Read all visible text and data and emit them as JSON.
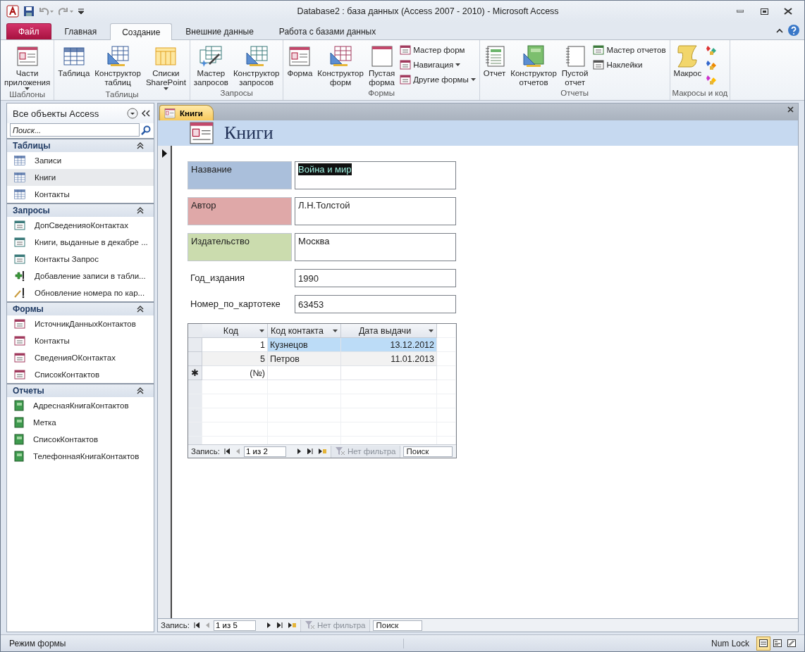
{
  "window": {
    "title": "Database2 : база данных (Access 2007 - 2010)  -  Microsoft Access"
  },
  "ribbon_tabs": [
    {
      "label": "Файл",
      "kind": "file",
      "selected": false
    },
    {
      "label": "Главная",
      "kind": "tab",
      "selected": false
    },
    {
      "label": "Создание",
      "kind": "tab",
      "selected": true
    },
    {
      "label": "Внешние данные",
      "kind": "tab",
      "selected": false
    },
    {
      "label": "Работа с базами данных",
      "kind": "tab",
      "selected": false
    }
  ],
  "ribbon_groups": [
    {
      "label": "Шаблоны",
      "items": [
        {
          "kind": "large",
          "lines": [
            "Части",
            "приложения"
          ],
          "dropdown": true
        }
      ]
    },
    {
      "label": "Таблицы",
      "items": [
        {
          "kind": "large",
          "lines": [
            "Таблица"
          ],
          "dropdown": false
        },
        {
          "kind": "large",
          "lines": [
            "Конструктор",
            "таблиц"
          ],
          "dropdown": false
        },
        {
          "kind": "large",
          "lines": [
            "Списки",
            "SharePoint"
          ],
          "dropdown": true
        }
      ]
    },
    {
      "label": "Запросы",
      "items": [
        {
          "kind": "large",
          "lines": [
            "Мастер",
            "запросов"
          ],
          "dropdown": false
        },
        {
          "kind": "large",
          "lines": [
            "Конструктор",
            "запросов"
          ],
          "dropdown": false
        }
      ]
    },
    {
      "label": "Формы",
      "items": [
        {
          "kind": "large",
          "lines": [
            "Форма"
          ],
          "dropdown": false
        },
        {
          "kind": "large",
          "lines": [
            "Конструктор",
            "форм"
          ],
          "dropdown": false
        },
        {
          "kind": "large",
          "lines": [
            "Пустая",
            "форма"
          ],
          "dropdown": false
        },
        {
          "kind": "small",
          "lines": [
            "Мастер форм"
          ],
          "dropdown": false
        },
        {
          "kind": "small",
          "lines": [
            "Навигация"
          ],
          "dropdown": true
        },
        {
          "kind": "small",
          "lines": [
            "Другие формы"
          ],
          "dropdown": true
        }
      ]
    },
    {
      "label": "Отчеты",
      "items": [
        {
          "kind": "large",
          "lines": [
            "Отчет"
          ],
          "dropdown": false
        },
        {
          "kind": "large",
          "lines": [
            "Конструктор",
            "отчетов"
          ],
          "dropdown": false
        },
        {
          "kind": "large",
          "lines": [
            "Пустой",
            "отчет"
          ],
          "dropdown": false
        },
        {
          "kind": "small",
          "lines": [
            "Мастер отчетов"
          ],
          "dropdown": false
        },
        {
          "kind": "small",
          "lines": [
            "Наклейки"
          ],
          "dropdown": false
        }
      ]
    },
    {
      "label": "Макросы и код",
      "items": [
        {
          "kind": "large",
          "lines": [
            "Макрос"
          ],
          "dropdown": false
        },
        {
          "kind": "icon"
        },
        {
          "kind": "icon"
        },
        {
          "kind": "icon"
        }
      ]
    }
  ],
  "nav_pane": {
    "title": "Все объекты Access",
    "search": {
      "placeholder": "Поиск..."
    },
    "groups": [
      {
        "title": "Таблицы",
        "expanded": true,
        "items": [
          {
            "label": "Записи",
            "kind": "table",
            "selected": false
          },
          {
            "label": "Книги",
            "kind": "table",
            "selected": true
          },
          {
            "label": "Контакты",
            "kind": "table",
            "selected": false
          }
        ]
      },
      {
        "title": "Запросы",
        "expanded": true,
        "items": [
          {
            "label": "ДопСведенияоКонтактах",
            "kind": "query",
            "selected": false
          },
          {
            "label": "Книги, выданные в декабре ...",
            "kind": "query",
            "selected": false
          },
          {
            "label": "Контакты Запрос",
            "kind": "query",
            "selected": false
          },
          {
            "label": "Добавление записи в табли...",
            "kind": "append",
            "selected": false
          },
          {
            "label": "Обновление номера по кар...",
            "kind": "update",
            "selected": false
          }
        ]
      },
      {
        "title": "Формы",
        "expanded": true,
        "items": [
          {
            "label": "ИсточникДанныхКонтактов",
            "kind": "form",
            "selected": false
          },
          {
            "label": "Контакты",
            "kind": "form",
            "selected": false
          },
          {
            "label": "СведенияОКонтактах",
            "kind": "form",
            "selected": false
          },
          {
            "label": "СписокКонтактов",
            "kind": "form",
            "selected": false
          }
        ]
      },
      {
        "title": "Отчеты",
        "expanded": true,
        "items": [
          {
            "label": "АдреснаяКнигаКонтактов",
            "kind": "report",
            "selected": false
          },
          {
            "label": "Метка",
            "kind": "report",
            "selected": false
          },
          {
            "label": "СписокКонтактов",
            "kind": "report",
            "selected": false
          },
          {
            "label": "ТелефоннаяКнигаКонтактов",
            "kind": "report",
            "selected": false
          }
        ]
      }
    ]
  },
  "document_tabs": [
    {
      "label": "Книги",
      "selected": true
    }
  ],
  "form": {
    "title": "Книги",
    "fields": [
      {
        "label": "Название",
        "value": "Война и мир",
        "color": "#aabfdb",
        "tall": true,
        "selected": true
      },
      {
        "label": "Автор",
        "value": "Л.Н.Толстой",
        "color": "#dfa8a8",
        "tall": true,
        "selected": false
      },
      {
        "label": "Издательство",
        "value": "Москва",
        "color": "#cbdcae",
        "tall": true,
        "selected": false
      },
      {
        "label": "Год_издания",
        "value": "1990",
        "tall": false,
        "selected": false
      },
      {
        "label": "Номер_по_картотеке",
        "value": "63453",
        "tall": false,
        "selected": false
      }
    ],
    "subform": {
      "columns": [
        {
          "label": "Код"
        },
        {
          "label": "Код контакта"
        },
        {
          "label": "Дата выдачи"
        }
      ],
      "rows": [
        {
          "cells": [
            "1",
            "Кузнецов",
            "13.12.2012"
          ],
          "selected": true
        },
        {
          "cells": [
            "5",
            "Петров",
            "11.01.2013"
          ],
          "selected": false
        }
      ],
      "new_row": {
        "marker": "✱",
        "placeholder": "(№)"
      },
      "navigator": {
        "label": "Запись:",
        "position": "1 из 2",
        "filter": "Нет фильтра",
        "search": {
          "placeholder": "Поиск"
        }
      }
    },
    "navigator": {
      "label": "Запись:",
      "position": "1 из 5",
      "filter": "Нет фильтра",
      "search": {
        "placeholder": "Поиск"
      }
    }
  },
  "status_bar": {
    "mode": "Режим формы",
    "num_lock": "Num Lock",
    "views": [
      {
        "selected": true
      },
      {
        "selected": false
      },
      {
        "selected": false
      }
    ]
  }
}
